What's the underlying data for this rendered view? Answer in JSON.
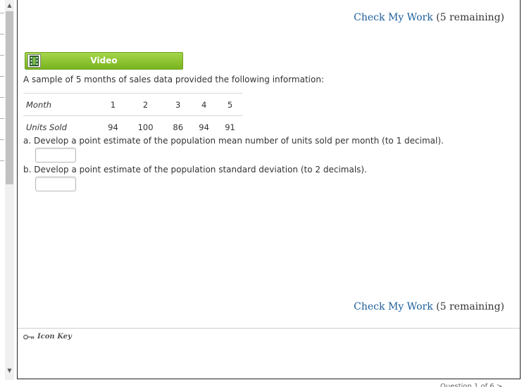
{
  "header": {
    "check_work_link": "Check My Work",
    "check_work_remaining": "(5 remaining)"
  },
  "video": {
    "label": "Video",
    "icon": "film-icon"
  },
  "problem": {
    "intro": "A sample of 5 months of sales data provided the following information:",
    "table": {
      "row1_label": "Month",
      "months": [
        "1",
        "2",
        "3",
        "4",
        "5"
      ],
      "row2_label": "Units Sold",
      "units": [
        "94",
        "100",
        "86",
        "94",
        "91"
      ]
    },
    "question_a": "a. Develop a point estimate of the population mean number of units sold per month (to 1 decimal).",
    "answer_a": "",
    "question_b": "b. Develop a point estimate of the population standard deviation (to 2 decimals).",
    "answer_b": ""
  },
  "footer": {
    "check_work_link": "Check My Work",
    "check_work_remaining": "(5 remaining)",
    "icon_key_label": "Icon Key",
    "question_nav": "Question 1 of 6 >"
  },
  "colors": {
    "link": "#1c5d99",
    "video_green": "#8cc63f"
  }
}
